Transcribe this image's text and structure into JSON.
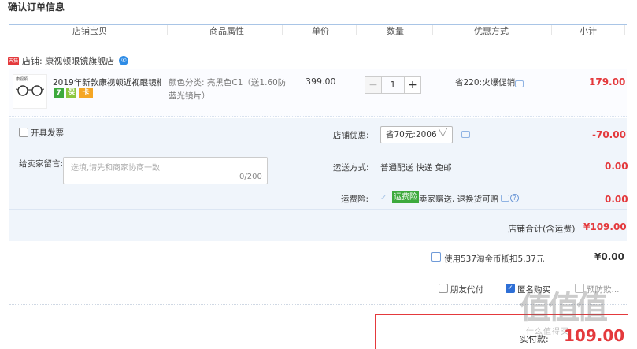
{
  "page": {
    "title": "确认订单信息"
  },
  "columns": [
    "店铺宝贝",
    "商品属性",
    "单价",
    "数量",
    "优惠方式",
    "小计"
  ],
  "shop": {
    "tag": "天猫",
    "label": "店铺: 康视顿眼镜旗舰店"
  },
  "item": {
    "thumb_brand": "康视顿",
    "title": "2019年新款康视顿近视眼镜框...",
    "badges": [
      "7",
      "保",
      "卡"
    ],
    "attr_line1": "颜色分类: 亮黑色C1（送1.60防",
    "attr_line2": "蓝光镜片）",
    "unit_price": "399.00",
    "quantity": "1",
    "minus": "−",
    "plus": "+",
    "promo": "省220:火爆促销",
    "subtotal": "179.00"
  },
  "invoice": {
    "label": "开具发票"
  },
  "note": {
    "label": "给卖家留言:",
    "placeholder": "选填,请先和商家协商一致",
    "count": "0/200"
  },
  "store_coupon": {
    "label": "店铺优惠:",
    "selected": "省70元:2006",
    "amount": "-70.00"
  },
  "shipping": {
    "label": "运送方式:",
    "value": "普通配送 快递 免邮",
    "amount": "0.00"
  },
  "insurance": {
    "label": "运费险:",
    "tag": "运费险",
    "desc": "卖家赠送, 退换货可赔",
    "amount": "0.00"
  },
  "shop_total": {
    "label": "店铺合计(含运费)",
    "value": "¥109.00"
  },
  "coins": {
    "label": "使用537淘金币抵扣5.37元",
    "value": "¥0.00"
  },
  "options": {
    "friend_pay": "朋友代付",
    "anonymous": "匿名购买",
    "after": "预防欺..."
  },
  "payment": {
    "label": "实付款:",
    "value": "109.00"
  },
  "watermark": {
    "text": "值值值",
    "url": "什么值得买"
  },
  "colors": {
    "accent_red": "#e4393c",
    "header_line": "#a9c5e6",
    "panel_bg": "#f0f5fb",
    "insurance_green": "#3daa3d"
  }
}
